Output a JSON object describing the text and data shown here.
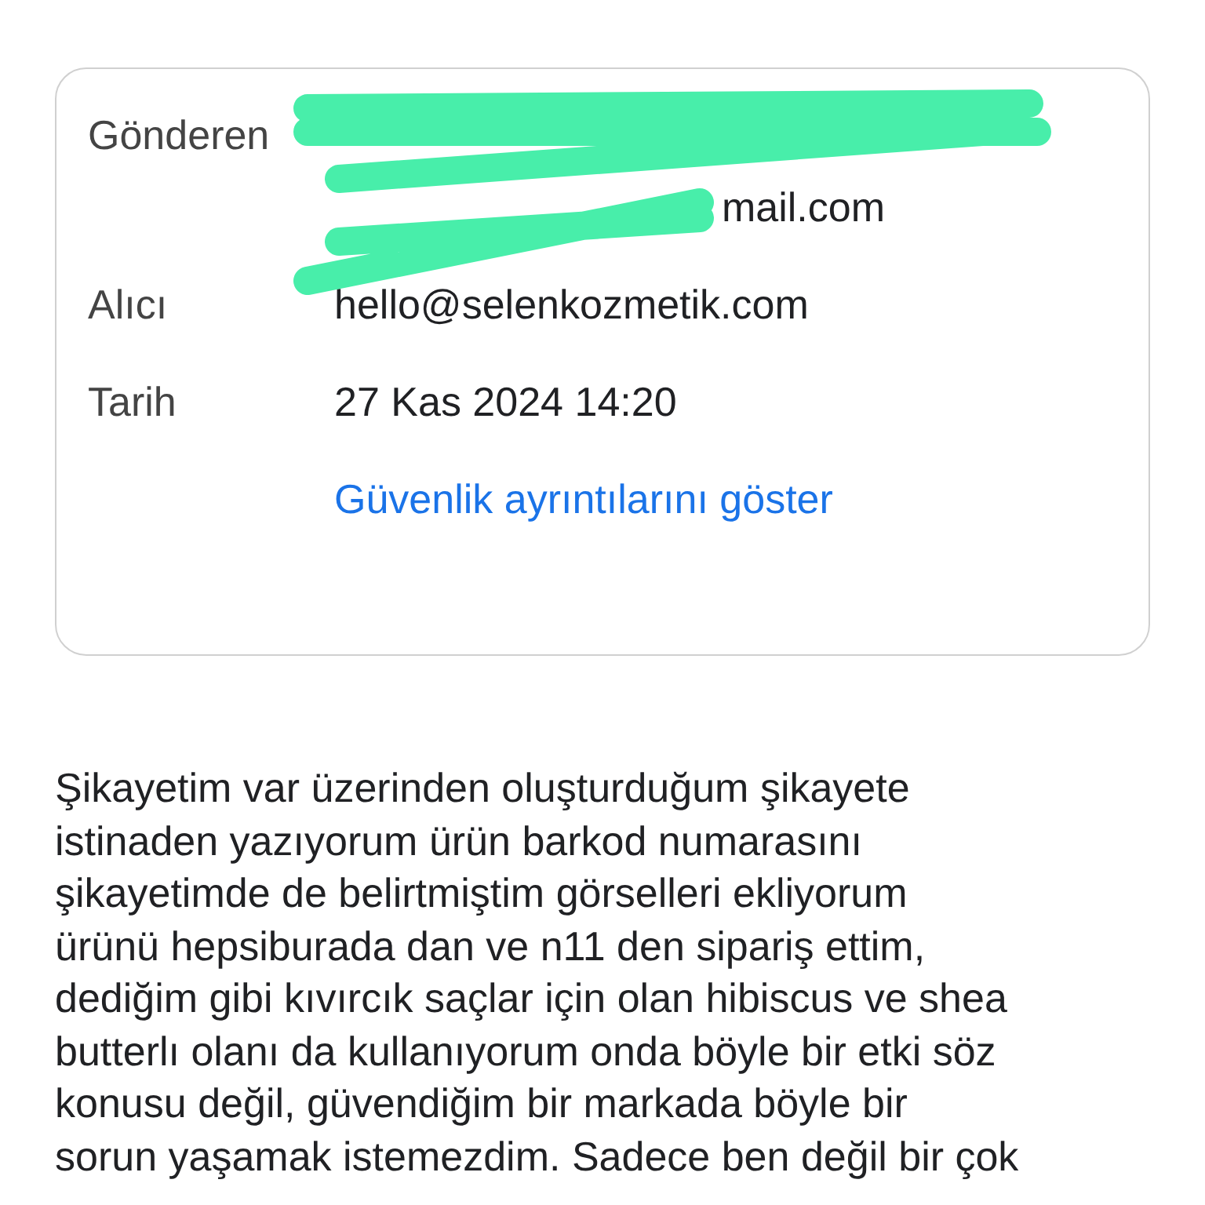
{
  "details": {
    "sender": {
      "label": "Gönderen",
      "email_visible_end": "mail.com",
      "redacted": true
    },
    "recipient": {
      "label": "Alıcı",
      "value": "hello@selenkozmetik.com"
    },
    "date": {
      "label": "Tarih",
      "value": "27 Kas 2024 14:20"
    },
    "security_link": "Güvenlik ayrıntılarını göster"
  },
  "body": {
    "lines": [
      "Şikayetim var üzerinden oluşturduğum şikayete",
      "istinaden yazıyorum ürün barkod numarasını",
      "şikayetimde de belirtmiştim görselleri ekliyorum",
      "ürünü hepsiburada dan ve n11 den sipariş ettim,",
      "dediğim gibi kıvırcık saçlar için olan hibiscus ve shea",
      "butterlı olanı da kullanıyorum onda böyle bir etki söz",
      "konusu değil, güvendiğim bir markada böyle bir",
      "sorun yaşamak istemezdim. Sadece ben değil bir çok"
    ]
  }
}
